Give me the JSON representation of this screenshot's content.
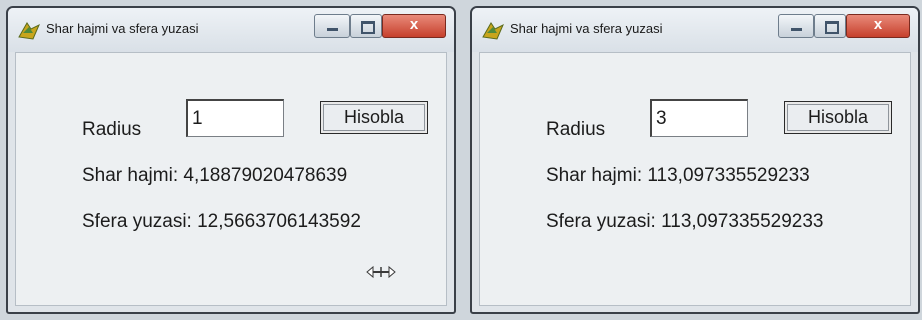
{
  "windows": [
    {
      "title": "Shar hajmi va sfera yuzasi",
      "radius_label": "Radius",
      "radius_value": "1",
      "calc_button": "Hisobla",
      "volume_text": "Shar hajmi: 4,18879020478639",
      "area_text": "Sfera yuzasi: 12,5663706143592",
      "icons": [
        "app-icon",
        "minimize-icon",
        "maximize-icon",
        "close-icon",
        "resize-cursor-icon"
      ]
    },
    {
      "title": "Shar hajmi va sfera yuzasi",
      "radius_label": "Radius",
      "radius_value": "3",
      "calc_button": "Hisobla",
      "volume_text": "Shar hajmi: 113,097335529233",
      "area_text": "Sfera yuzasi: 113,097335529233",
      "icons": [
        "app-icon",
        "minimize-icon",
        "maximize-icon",
        "close-icon"
      ]
    }
  ],
  "colors": {
    "close_button": "#c6402c",
    "window_background": "#edf0f2"
  }
}
